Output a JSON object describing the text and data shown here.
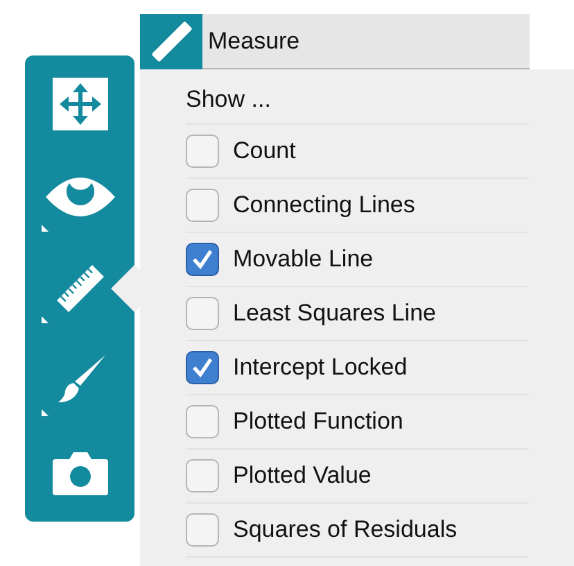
{
  "toolbar": {
    "tools": [
      {
        "kind": "move",
        "selected": false,
        "has_submenu": false
      },
      {
        "kind": "eye",
        "selected": false,
        "has_submenu": true
      },
      {
        "kind": "ruler",
        "selected": true,
        "has_submenu": true
      },
      {
        "kind": "brush",
        "selected": false,
        "has_submenu": true
      },
      {
        "kind": "camera",
        "selected": false,
        "has_submenu": false
      }
    ]
  },
  "panel": {
    "title": "Measure",
    "section_label": "Show ...",
    "options": [
      {
        "label": "Count",
        "checked": false
      },
      {
        "label": "Connecting Lines",
        "checked": false
      },
      {
        "label": "Movable Line",
        "checked": true
      },
      {
        "label": "Least Squares Line",
        "checked": false
      },
      {
        "label": "Intercept Locked",
        "checked": true
      },
      {
        "label": "Plotted Function",
        "checked": false
      },
      {
        "label": "Plotted Value",
        "checked": false
      },
      {
        "label": "Squares of Residuals",
        "checked": false
      }
    ]
  }
}
